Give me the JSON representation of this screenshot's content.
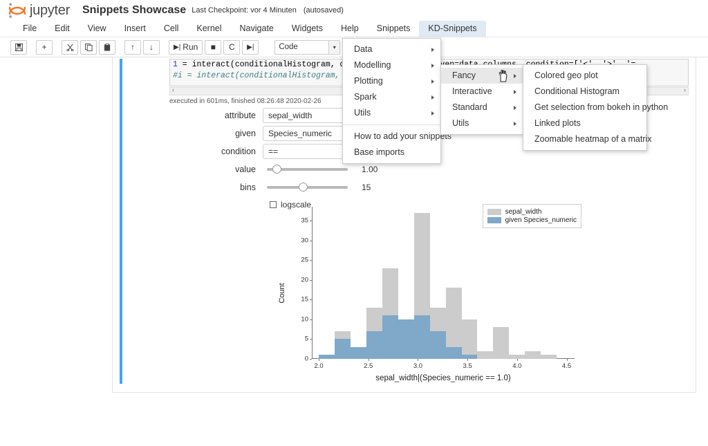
{
  "header": {
    "logo_text": "jupyter",
    "notebook_name": "Snippets Showcase",
    "checkpoint": "Last Checkpoint: vor 4 Minuten",
    "autosaved": "(autosaved)"
  },
  "menubar": {
    "items": [
      {
        "label": "File",
        "active": false
      },
      {
        "label": "Edit",
        "active": false
      },
      {
        "label": "View",
        "active": false
      },
      {
        "label": "Insert",
        "active": false
      },
      {
        "label": "Cell",
        "active": false
      },
      {
        "label": "Kernel",
        "active": false
      },
      {
        "label": "Navigate",
        "active": false
      },
      {
        "label": "Widgets",
        "active": false
      },
      {
        "label": "Help",
        "active": false
      },
      {
        "label": "Snippets",
        "active": false
      },
      {
        "label": "KD-Snippets",
        "active": true
      }
    ]
  },
  "toolbar": {
    "save": "ὋE",
    "save_icon": "save-icon",
    "insert_below": "+",
    "cut": "✂",
    "copy": "copy-icon",
    "paste": "paste-icon",
    "move_up": "↑",
    "move_down": "↓",
    "run_label": "Run",
    "interrupt": "■",
    "restart": "C",
    "restart_run_all": "➤➤",
    "celltype": "Code",
    "command_palette": "keyboard-icon",
    "toc": "toc-icon",
    "snippets_diamond": "diamond-icon",
    "graduation": "graduation-icon",
    "extra": "extra-icon"
  },
  "cell": {
    "prompt": "1",
    "code_line_1": " = interact(conditionalHistogram, data=data.columns, given=data.columns, condition=['<', '>', '=",
    "code_line_2": "#i = interact(conditionalHistogram, att                                              =data.labe",
    "scroll_left": "‹",
    "scroll_right": "›",
    "exec_info": "executed in 601ms, finished 08:26:48 2020-02-26"
  },
  "widgets": {
    "attribute": {
      "label": "attribute",
      "value": "sepal_width"
    },
    "given": {
      "label": "given",
      "value": "Species_numeric"
    },
    "condition": {
      "label": "condition",
      "value": "=="
    },
    "value": {
      "label": "value",
      "display": "1.00",
      "fraction": 0.08
    },
    "bins": {
      "label": "bins",
      "display": "15",
      "fraction": 0.44
    },
    "logscale": {
      "label": "logscale",
      "checked": false
    }
  },
  "menus": {
    "kd_snippets": {
      "items": [
        {
          "label": "Data",
          "submenu": true,
          "highlighted": false
        },
        {
          "label": "Modelling",
          "submenu": true,
          "highlighted": false
        },
        {
          "label": "Plotting",
          "submenu": true,
          "highlighted": false
        },
        {
          "label": "Spark",
          "submenu": true,
          "highlighted": false
        },
        {
          "label": "Utils",
          "submenu": true,
          "highlighted": false
        }
      ],
      "footer_items": [
        {
          "label": "How to add your snippets",
          "submenu": false
        },
        {
          "label": "Base imports",
          "submenu": false
        }
      ]
    },
    "plotting": {
      "items": [
        {
          "label": "Fancy",
          "submenu": true,
          "highlighted": true
        },
        {
          "label": "Interactive",
          "submenu": true,
          "highlighted": false
        },
        {
          "label": "Standard",
          "submenu": true,
          "highlighted": false
        },
        {
          "label": "Utils",
          "submenu": true,
          "highlighted": false
        }
      ]
    },
    "fancy": {
      "items": [
        {
          "label": "Colored geo plot",
          "submenu": false
        },
        {
          "label": "Conditional Histogram",
          "submenu": false
        },
        {
          "label": "Get selection from bokeh in python",
          "submenu": false
        },
        {
          "label": "Linked plots",
          "submenu": false
        },
        {
          "label": "Zoomable heatmap of a matrix",
          "submenu": false
        }
      ]
    }
  },
  "colors": {
    "accent_blue": "#42A5F5",
    "tab_active": "#dfeaf4",
    "bar_gray": "#cccccc",
    "bar_blue": "#7fa8c9",
    "jupyter_orange": "#F37726"
  },
  "chart_data": {
    "type": "bar",
    "chart_subtype": "histogram",
    "title": "",
    "xlabel": "sepal_width|(Species_numeric == 1.0)",
    "ylabel": "Count",
    "xlim": [
      1.93,
      4.58
    ],
    "ylim": [
      0,
      38.5
    ],
    "xticks": [
      2.0,
      2.5,
      3.0,
      3.5,
      4.0,
      4.5
    ],
    "xtick_labels": [
      "2.0",
      "2.5",
      "3.0",
      "3.5",
      "4.0",
      "4.5"
    ],
    "yticks": [
      0,
      5,
      10,
      15,
      20,
      25,
      30,
      35
    ],
    "ytick_labels": [
      "0",
      "5",
      "10",
      "15",
      "20",
      "25",
      "30",
      "35"
    ],
    "grid": false,
    "bins": 15,
    "bin_edges": [
      2.0,
      2.16,
      2.32,
      2.48,
      2.64,
      2.8,
      2.96,
      3.12,
      3.28,
      3.44,
      3.6,
      3.76,
      3.92,
      4.08,
      4.24,
      4.4
    ],
    "legend_position": "upper right",
    "series": [
      {
        "name": "sepal_width",
        "color": "#cccccc",
        "values": [
          1,
          7,
          3,
          13,
          23,
          10,
          37,
          13,
          18,
          10,
          2,
          8,
          1,
          2,
          1
        ]
      },
      {
        "name": "given Species_numeric",
        "color": "#7fa8c9",
        "values": [
          1,
          5,
          3,
          7,
          11,
          10,
          11,
          7,
          3,
          1,
          0,
          0,
          0,
          0,
          0
        ]
      }
    ]
  }
}
